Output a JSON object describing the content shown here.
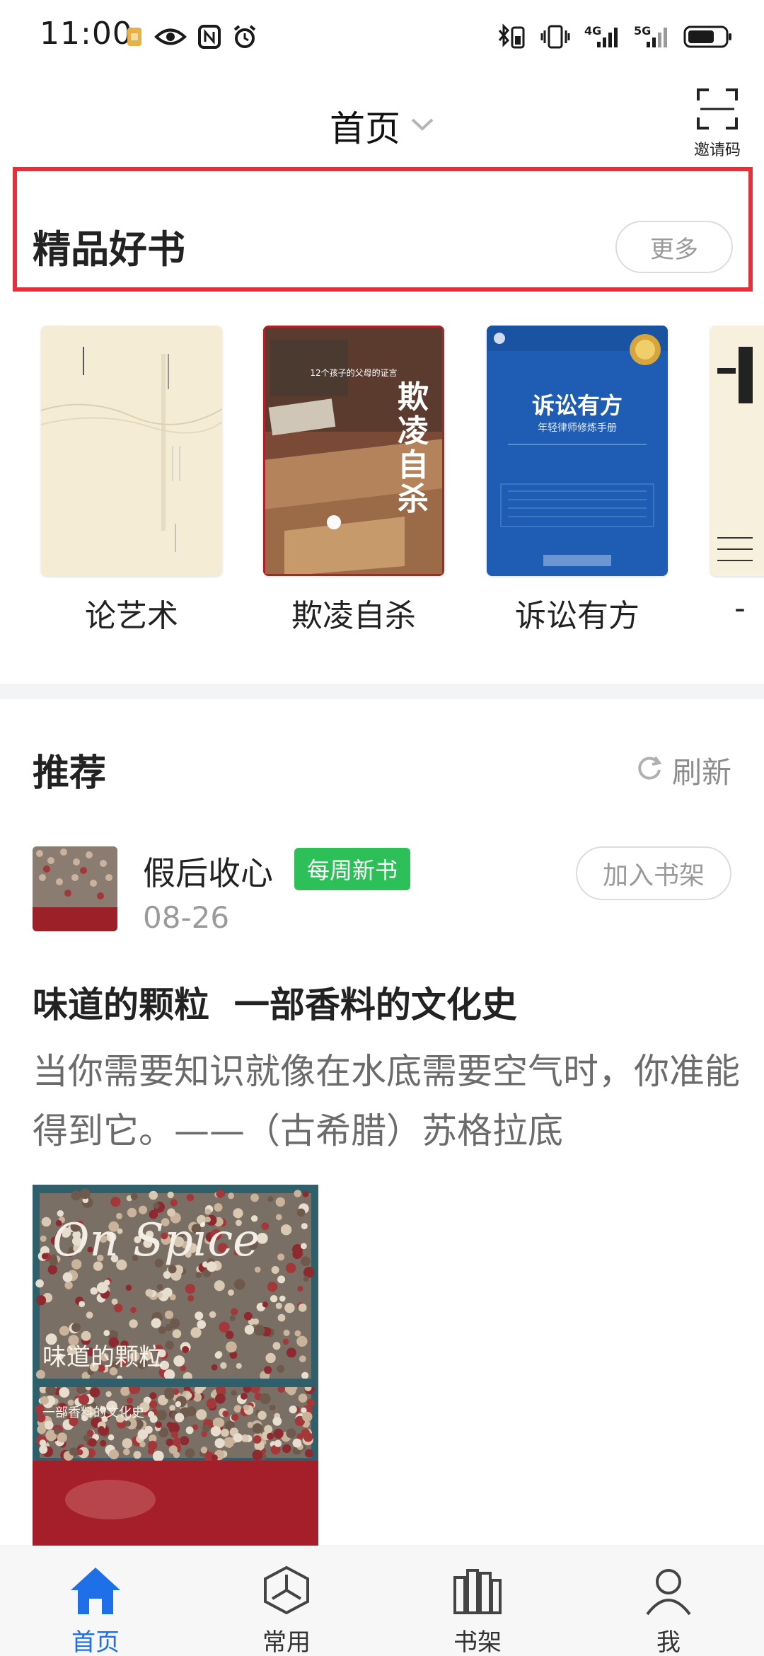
{
  "status_bar": {
    "time": "11:00",
    "network_1": "4G",
    "network_2": "5G"
  },
  "header": {
    "title": "首页",
    "invite_label": "邀请码"
  },
  "featured": {
    "title": "精品好书",
    "more_label": "更多",
    "books": [
      {
        "title": "论艺术"
      },
      {
        "title": "欺凌自杀",
        "cover_tagline": "12个孩子的父母的证言",
        "cover_title": "欺凌自杀"
      },
      {
        "title": "诉讼有方",
        "cover_title": "诉讼有方",
        "cover_subtitle": "年轻律师修炼手册"
      },
      {
        "title": "-"
      }
    ]
  },
  "recommend": {
    "title": "推荐",
    "refresh_label": "刷新",
    "post": {
      "author": "假后收心",
      "badge": "每周新书",
      "date": "08-26",
      "add_shelf_label": "加入书架",
      "headline": "味道的颗粒  一部香料的文化史",
      "quote": "当你需要知识就像在水底需要空气时，你准能得到它。——（古希腊）苏格拉底",
      "image_title": "味道的颗粒",
      "image_subtitle": "一部香料的文化史",
      "image_logo": "On Spice"
    }
  },
  "nav": {
    "items": [
      {
        "label": "首页",
        "icon": "home-icon",
        "active": true
      },
      {
        "label": "常用",
        "icon": "compass-icon",
        "active": false
      },
      {
        "label": "书架",
        "icon": "bookshelf-icon",
        "active": false
      },
      {
        "label": "我",
        "icon": "person-icon",
        "active": false
      }
    ]
  },
  "colors": {
    "accent": "#1e6fe8",
    "highlight_border": "#e3303a",
    "badge_green": "#2dbf58"
  }
}
